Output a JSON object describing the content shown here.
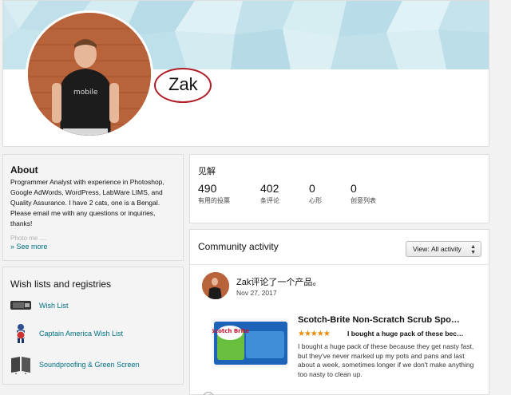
{
  "profile": {
    "name": "Zak"
  },
  "about": {
    "title": "About",
    "text": "Programmer Analyst with experience in Photoshop, Google AdWords, WordPress, LabWare LIMS, and Quality Assurance. I have 2 cats, one is a Bengal. Please email me with any questions or inquiries, thanks!",
    "faded_text": "Photo me ....",
    "see_more": "» See more"
  },
  "wishlists": {
    "title": "Wish lists and registries",
    "items": [
      {
        "label": "Wish List",
        "icon": "product-thumbnail-icon"
      },
      {
        "label": "Captain America Wish List",
        "icon": "action-figure-icon"
      },
      {
        "label": "Soundproofing & Green Screen",
        "icon": "panel-icon"
      }
    ]
  },
  "insights": {
    "title": "见解",
    "stats": [
      {
        "value": "490",
        "label": "有用的投票"
      },
      {
        "value": "402",
        "label": "条评论"
      },
      {
        "value": "0",
        "label": "心形"
      },
      {
        "value": "0",
        "label": "创意列表"
      }
    ]
  },
  "community": {
    "title": "Community activity",
    "view_label": "View:",
    "view_value": "All activity",
    "activity_text": "Zak评论了一个产品。",
    "activity_date": "Nov 27, 2017",
    "product_title": "Scotch-Brite Non-Scratch Scrub Spo…",
    "stars": "★★★★★",
    "review_headline": "I bought a huge pack of these bec…",
    "review_body": "I bought a huge pack of these because they get nasty fast, but they've never marked up my pots and pans and last about a week, sometimes longer if we don't make anything too nasty to clean up.",
    "product_brand": "Scotch Brite"
  },
  "colors": {
    "link": "#007185",
    "star": "#e78b07",
    "annotation": "#b01c26",
    "banner": "#cfe8ef"
  }
}
